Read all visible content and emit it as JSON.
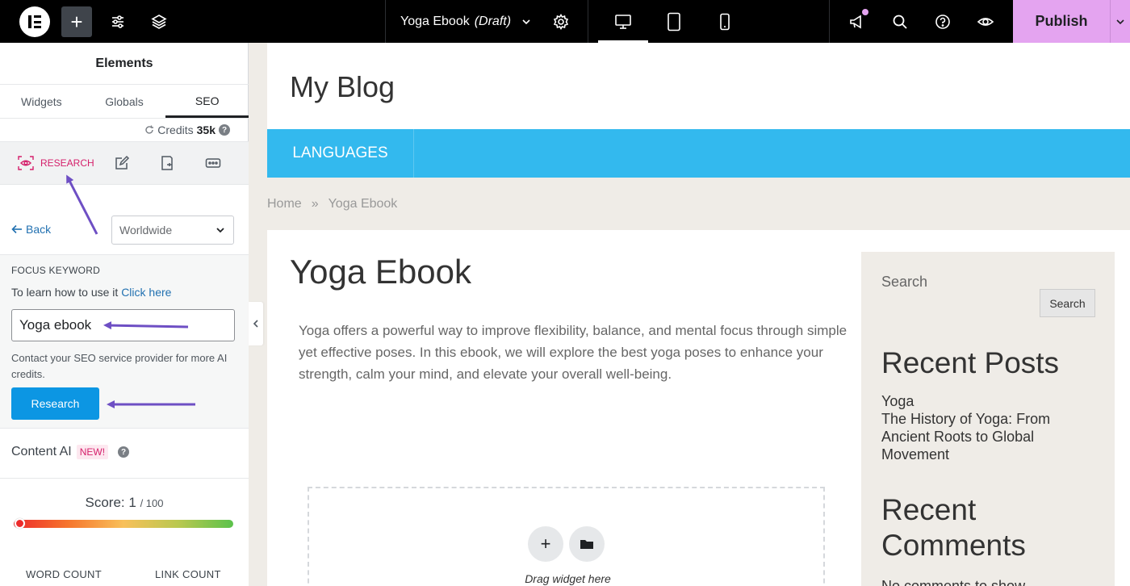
{
  "toolbar": {
    "doc_name": "Yoga Ebook",
    "doc_status": "(Draft)",
    "publish_label": "Publish"
  },
  "panel": {
    "title": "Elements",
    "tabs": [
      {
        "label": "Widgets"
      },
      {
        "label": "Globals"
      },
      {
        "label": "SEO"
      }
    ],
    "credits_label": "Credits",
    "credits_value": "35k",
    "research_tab_label": "RESEARCH",
    "back_label": "Back",
    "region_value": "Worldwide",
    "focus_keyword_label": "FOCUS KEYWORD",
    "help_text": "To learn how to use it",
    "help_link": "Click here",
    "keyword_value": "Yoga ebook",
    "credits_note": "Contact your SEO service provider for more AI credits.",
    "research_button": "Research",
    "content_ai_label": "Content AI",
    "new_badge": "NEW!",
    "score_label": "Score:",
    "score_value": "1",
    "score_max": "/ 100",
    "score_fraction": 0.01,
    "word_count_label": "WORD COUNT",
    "link_count_label": "LINK COUNT"
  },
  "site": {
    "title": "My Blog",
    "nav_item": "LANGUAGES",
    "breadcrumb_home": "Home",
    "breadcrumb_sep": "»",
    "breadcrumb_current": "Yoga Ebook",
    "post_title": "Yoga Ebook",
    "post_body": "Yoga offers a powerful way to improve flexibility, balance, and mental focus through simple yet effective poses. In this ebook, we will explore the best yoga poses to enhance your strength, calm your mind, and elevate your overall well-being.",
    "drop_text": "Drag widget here",
    "sidebar": {
      "search_label": "Search",
      "search_button": "Search",
      "recent_posts_title": "Recent Posts",
      "recent_posts": [
        "Yoga",
        "The History of Yoga: From Ancient Roots to Global Movement"
      ],
      "recent_comments_title": "Recent Comments",
      "no_comments": "No comments to show."
    }
  },
  "colors": {
    "accent_pink": "#e4a4f0",
    "research_pink": "#d5206b",
    "nav_blue": "#33b9ee",
    "button_blue": "#0c96e3",
    "annotation_arrow": "#6e4fc4"
  }
}
